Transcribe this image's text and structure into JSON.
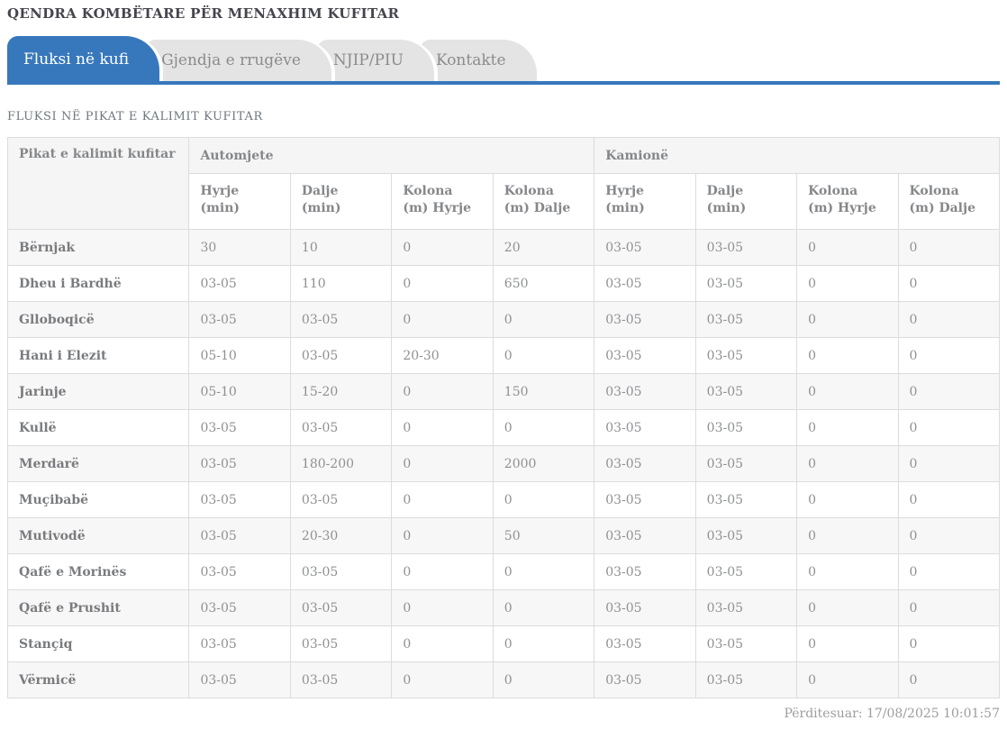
{
  "page": {
    "title": "QENDRA KOMBËTARE PËR MENAXHIM KUFITAR",
    "updated": "Përditesuar: 17/08/2025 10:01:57"
  },
  "tabs": [
    {
      "label": "Fluksi në kufi",
      "active": true
    },
    {
      "label": "Gjendja e rrugëve",
      "active": false
    },
    {
      "label": "NJIP/PIU",
      "active": false
    },
    {
      "label": "Kontakte",
      "active": false
    }
  ],
  "section": {
    "title": "FLUKSI NË PIKAT E KALIMIT KUFITAR"
  },
  "table": {
    "corner_header": "Pikat e kalimit kufitar",
    "groups": [
      {
        "label": "Automjete"
      },
      {
        "label": "Kamionë"
      }
    ],
    "subheaders": [
      "Hyrje (min)",
      "Dalje (min)",
      "Kolona (m) Hyrje",
      "Kolona (m) Dalje"
    ],
    "rows": [
      {
        "name": "Bërnjak",
        "values": [
          "30",
          "10",
          "0",
          "20",
          "03-05",
          "03-05",
          "0",
          "0"
        ]
      },
      {
        "name": "Dheu i Bardhë",
        "values": [
          "03-05",
          "110",
          "0",
          "650",
          "03-05",
          "03-05",
          "0",
          "0"
        ]
      },
      {
        "name": "Glloboqicë",
        "values": [
          "03-05",
          "03-05",
          "0",
          "0",
          "03-05",
          "03-05",
          "0",
          "0"
        ]
      },
      {
        "name": "Hani i Elezit",
        "values": [
          "05-10",
          "03-05",
          "20-30",
          "0",
          "03-05",
          "03-05",
          "0",
          "0"
        ]
      },
      {
        "name": "Jarinje",
        "values": [
          "05-10",
          "15-20",
          "0",
          "150",
          "03-05",
          "03-05",
          "0",
          "0"
        ]
      },
      {
        "name": "Kullë",
        "values": [
          "03-05",
          "03-05",
          "0",
          "0",
          "03-05",
          "03-05",
          "0",
          "0"
        ]
      },
      {
        "name": "Merdarë",
        "values": [
          "03-05",
          "180-200",
          "0",
          "2000",
          "03-05",
          "03-05",
          "0",
          "0"
        ]
      },
      {
        "name": "Muçibabë",
        "values": [
          "03-05",
          "03-05",
          "0",
          "0",
          "03-05",
          "03-05",
          "0",
          "0"
        ]
      },
      {
        "name": "Mutivodë",
        "values": [
          "03-05",
          "20-30",
          "0",
          "50",
          "03-05",
          "03-05",
          "0",
          "0"
        ]
      },
      {
        "name": "Qafë e Morinës",
        "values": [
          "03-05",
          "03-05",
          "0",
          "0",
          "03-05",
          "03-05",
          "0",
          "0"
        ]
      },
      {
        "name": "Qafë e Prushit",
        "values": [
          "03-05",
          "03-05",
          "0",
          "0",
          "03-05",
          "03-05",
          "0",
          "0"
        ]
      },
      {
        "name": "Stançiq",
        "values": [
          "03-05",
          "03-05",
          "0",
          "0",
          "03-05",
          "03-05",
          "0",
          "0"
        ]
      },
      {
        "name": "Vërmicë",
        "values": [
          "03-05",
          "03-05",
          "0",
          "0",
          "03-05",
          "03-05",
          "0",
          "0"
        ]
      }
    ]
  },
  "colors": {
    "accent_blue": "#3778bc",
    "tab_inactive_bg": "#e4e4e4",
    "header_bg": "#f5f5f5",
    "stripe_bg": "#f7f7f7",
    "border": "#dcdcdc",
    "title_text": "#45454d",
    "muted_text": "#8e9093"
  }
}
